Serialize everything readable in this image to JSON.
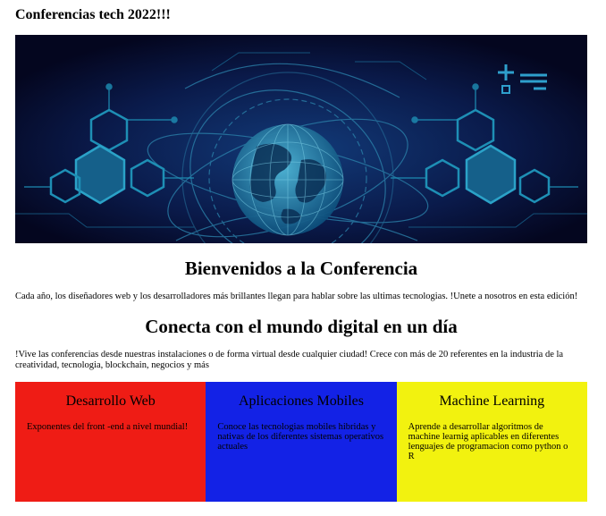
{
  "header": {
    "title": "Conferencias tech 2022!!!"
  },
  "hero": {
    "icon": "globe-network-illustration",
    "background": "#05082a",
    "accent": "#1e7fa0"
  },
  "welcome": {
    "heading": "Bienvenidos a la Conferencia",
    "text": "Cada año, los diseñadores web y los desarrolladores más brillantes llegan para hablar sobre las ultimas tecnologias. !Unete a nosotros en esta edición!"
  },
  "connect": {
    "heading": "Conecta con el mundo digital en un día",
    "text": "!Vive las conferencias desde nuestras instalaciones o de forma virtual desde cualquier ciudad! Crece con más de 20 referentes en la industria de la creatividad, tecnologia, blockchain, negocios y más"
  },
  "cards": [
    {
      "title": "Desarrollo Web",
      "text": "Exponentes del front -end a nivel mundial!",
      "color": "#ef1c15"
    },
    {
      "title": "Aplicaciones Mobiles",
      "text": "Conoce las tecnologias mobiles hibridas y nativas de los diferentes sistemas operativos actuales",
      "color": "#1322e6"
    },
    {
      "title": "Machine Learning",
      "text": "Aprende a desarrollar algoritmos de machine learnig aplicables en diferentes lenguajes de programacion como python o R",
      "color": "#f2f20f"
    }
  ]
}
